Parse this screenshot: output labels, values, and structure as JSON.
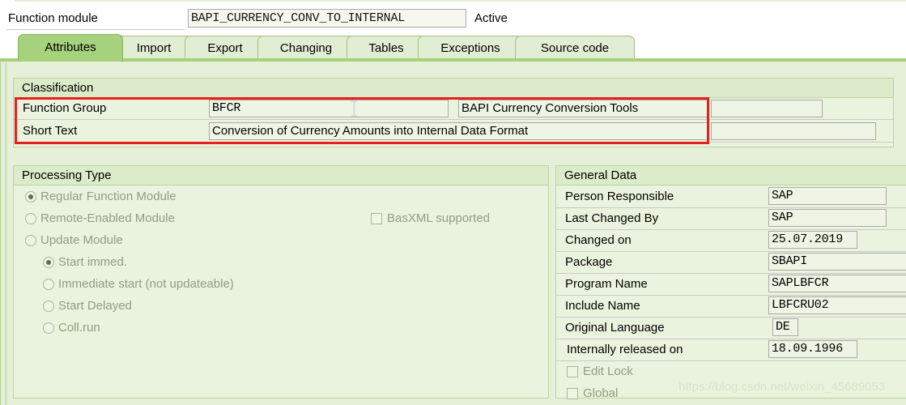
{
  "header": {
    "label": "Function module",
    "name_value": "BAPI_CURRENCY_CONV_TO_INTERNAL",
    "status": "Active"
  },
  "tabs": [
    {
      "label": "Attributes",
      "active": true
    },
    {
      "label": "Import",
      "active": false
    },
    {
      "label": "Export",
      "active": false
    },
    {
      "label": "Changing",
      "active": false
    },
    {
      "label": "Tables",
      "active": false
    },
    {
      "label": "Exceptions",
      "active": false
    },
    {
      "label": "Source code",
      "active": false
    }
  ],
  "classification": {
    "title": "Classification",
    "function_group": {
      "label": "Function Group",
      "value": "BFCR",
      "description": "BAPI Currency Conversion Tools",
      "extra": ""
    },
    "short_text": {
      "label": "Short Text",
      "value": "Conversion of Currency Amounts into Internal Data Format",
      "extra": ""
    }
  },
  "processing_type": {
    "title": "Processing Type",
    "options": [
      {
        "label": "Regular Function Module",
        "selected": true,
        "type": "radio",
        "indent": 0
      },
      {
        "label": "Remote-Enabled Module",
        "selected": false,
        "type": "radio",
        "indent": 0
      },
      {
        "label": "Update Module",
        "selected": false,
        "type": "radio",
        "indent": 0
      },
      {
        "label": "Start immed.",
        "selected": true,
        "type": "radio",
        "indent": 1
      },
      {
        "label": "Immediate start (not updateable)",
        "selected": false,
        "type": "radio",
        "indent": 1
      },
      {
        "label": "Start Delayed",
        "selected": false,
        "type": "radio",
        "indent": 1
      },
      {
        "label": "Coll.run",
        "selected": false,
        "type": "radio",
        "indent": 1
      }
    ],
    "basxml": {
      "label": "BasXML supported",
      "checked": false
    }
  },
  "general_data": {
    "title": "General Data",
    "rows": [
      {
        "label": "Person Responsible",
        "value": "SAP"
      },
      {
        "label": "Last Changed By",
        "value": "SAP"
      },
      {
        "label": "Changed on",
        "value": "25.07.2019"
      },
      {
        "label": "Package",
        "value": "SBAPI"
      },
      {
        "label": "Program Name",
        "value": "SAPLBFCR"
      },
      {
        "label": "Include Name",
        "value": "LBFCRU02"
      },
      {
        "label": "Original Language",
        "value": "DE"
      },
      {
        "label": "Internally released on",
        "value": "18.09.1996"
      }
    ],
    "checkboxes": [
      {
        "label": "Edit Lock",
        "checked": false
      },
      {
        "label": "Global",
        "checked": false
      }
    ]
  },
  "watermark": "https://blog.csdn.net/weixin_45689053",
  "colors": {
    "accent_green": "#a6d17d",
    "panel_bg": "#eaf3dd",
    "content_bg": "#e6f0d8",
    "highlight_red": "#e8201c"
  }
}
